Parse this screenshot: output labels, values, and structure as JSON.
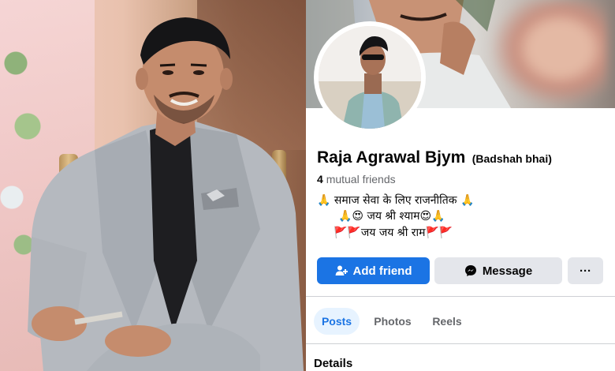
{
  "profile": {
    "name": "Raja Agrawal Bjym",
    "nickname": "(Badshah bhai)",
    "mutual_count": "4",
    "mutual_label": "mutual friends",
    "bio_lines": [
      "🙏 समाज सेवा के लिए राजनीतिक 🙏",
      "🙏😍 जय श्री श्याम😍🙏",
      "🚩🚩जय जय श्री राम🚩🚩"
    ]
  },
  "actions": {
    "add_friend": "Add friend",
    "message": "Message",
    "more": "···"
  },
  "tabs": [
    "Posts",
    "Photos",
    "Reels"
  ],
  "active_tab": "Posts",
  "sections": {
    "details": "Details"
  },
  "colors": {
    "primary": "#1b74e4",
    "secondary_button": "#e4e6eb",
    "active_tab_bg": "#e7f3ff"
  },
  "icons": {
    "add_friend": "add-person-icon",
    "message": "messenger-icon",
    "more": "more-dots-icon"
  }
}
